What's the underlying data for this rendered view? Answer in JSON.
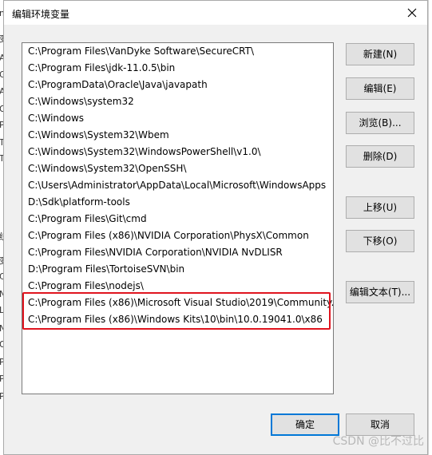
{
  "window": {
    "title": "编辑环境变量",
    "close_label": "✕"
  },
  "paths": [
    "C:\\Program Files\\VanDyke Software\\SecureCRT\\",
    "C:\\Program Files\\jdk-11.0.5\\bin",
    "C:\\ProgramData\\Oracle\\Java\\javapath",
    "C:\\Windows\\system32",
    "C:\\Windows",
    "C:\\Windows\\System32\\Wbem",
    "C:\\Windows\\System32\\WindowsPowerShell\\v1.0\\",
    "C:\\Windows\\System32\\OpenSSH\\",
    "C:\\Users\\Administrator\\AppData\\Local\\Microsoft\\WindowsApps",
    "D:\\Sdk\\platform-tools",
    "C:\\Program Files\\Git\\cmd",
    "C:\\Program Files (x86)\\NVIDIA Corporation\\PhysX\\Common",
    "C:\\Program Files\\NVIDIA Corporation\\NVIDIA NvDLISR",
    "D:\\Program Files\\TortoiseSVN\\bin",
    "C:\\Program Files\\nodejs\\",
    "C:\\Program Files (x86)\\Microsoft Visual Studio\\2019\\Community...",
    "C:\\Program Files (x86)\\Windows Kits\\10\\bin\\10.0.19041.0\\x86"
  ],
  "buttons": {
    "new": "新建(N)",
    "edit": "编辑(E)",
    "browse": "浏览(B)...",
    "delete": "删除(D)",
    "move_up": "上移(U)",
    "move_down": "下移(O)",
    "edit_text": "编辑文本(T)..."
  },
  "footer": {
    "ok": "确定",
    "cancel": "取消"
  },
  "watermark": "CSDN @比不过比",
  "background_fragments": [
    "m",
    "变",
    "A",
    "G",
    "A",
    "O",
    "P",
    "T",
    "T",
    "统",
    "变",
    "C",
    "N",
    "L",
    "N",
    "O",
    "P",
    "P",
    "P"
  ],
  "colors": {
    "highlight": "#e0141e",
    "focus": "#0078d7"
  }
}
